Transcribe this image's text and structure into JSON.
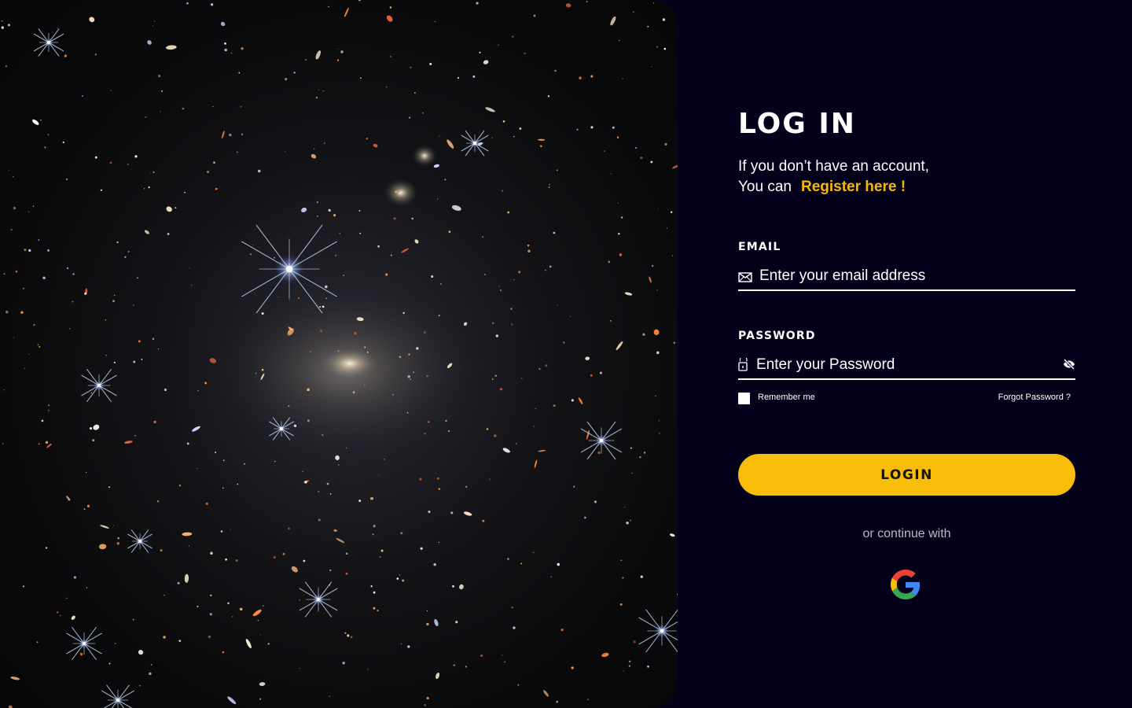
{
  "hero": {
    "image": "deep-field-galaxy-image"
  },
  "login": {
    "title": "LOG IN",
    "intro_line1": "If you don’t have an account,",
    "intro_line2": "You can",
    "register_link": "Register here !",
    "email": {
      "label": "EMAIL",
      "placeholder": "Enter your email address",
      "value": "",
      "icon": "mail-icon"
    },
    "password": {
      "label": "PASSWORD",
      "placeholder": "Enter your Password",
      "value": "",
      "icon": "lock-icon",
      "toggle_icon": "eye-off-icon"
    },
    "remember_me": "Remember me",
    "remember_checked": false,
    "forgot_password": "Forgot Password ?",
    "login_button": "LOGIN",
    "continue_with": "or continue with",
    "social": [
      "google-icon"
    ]
  },
  "colors": {
    "background": "#04021a",
    "accent": "#f8bd08",
    "text": "#ffffff",
    "muted": "#b9b8c2"
  }
}
